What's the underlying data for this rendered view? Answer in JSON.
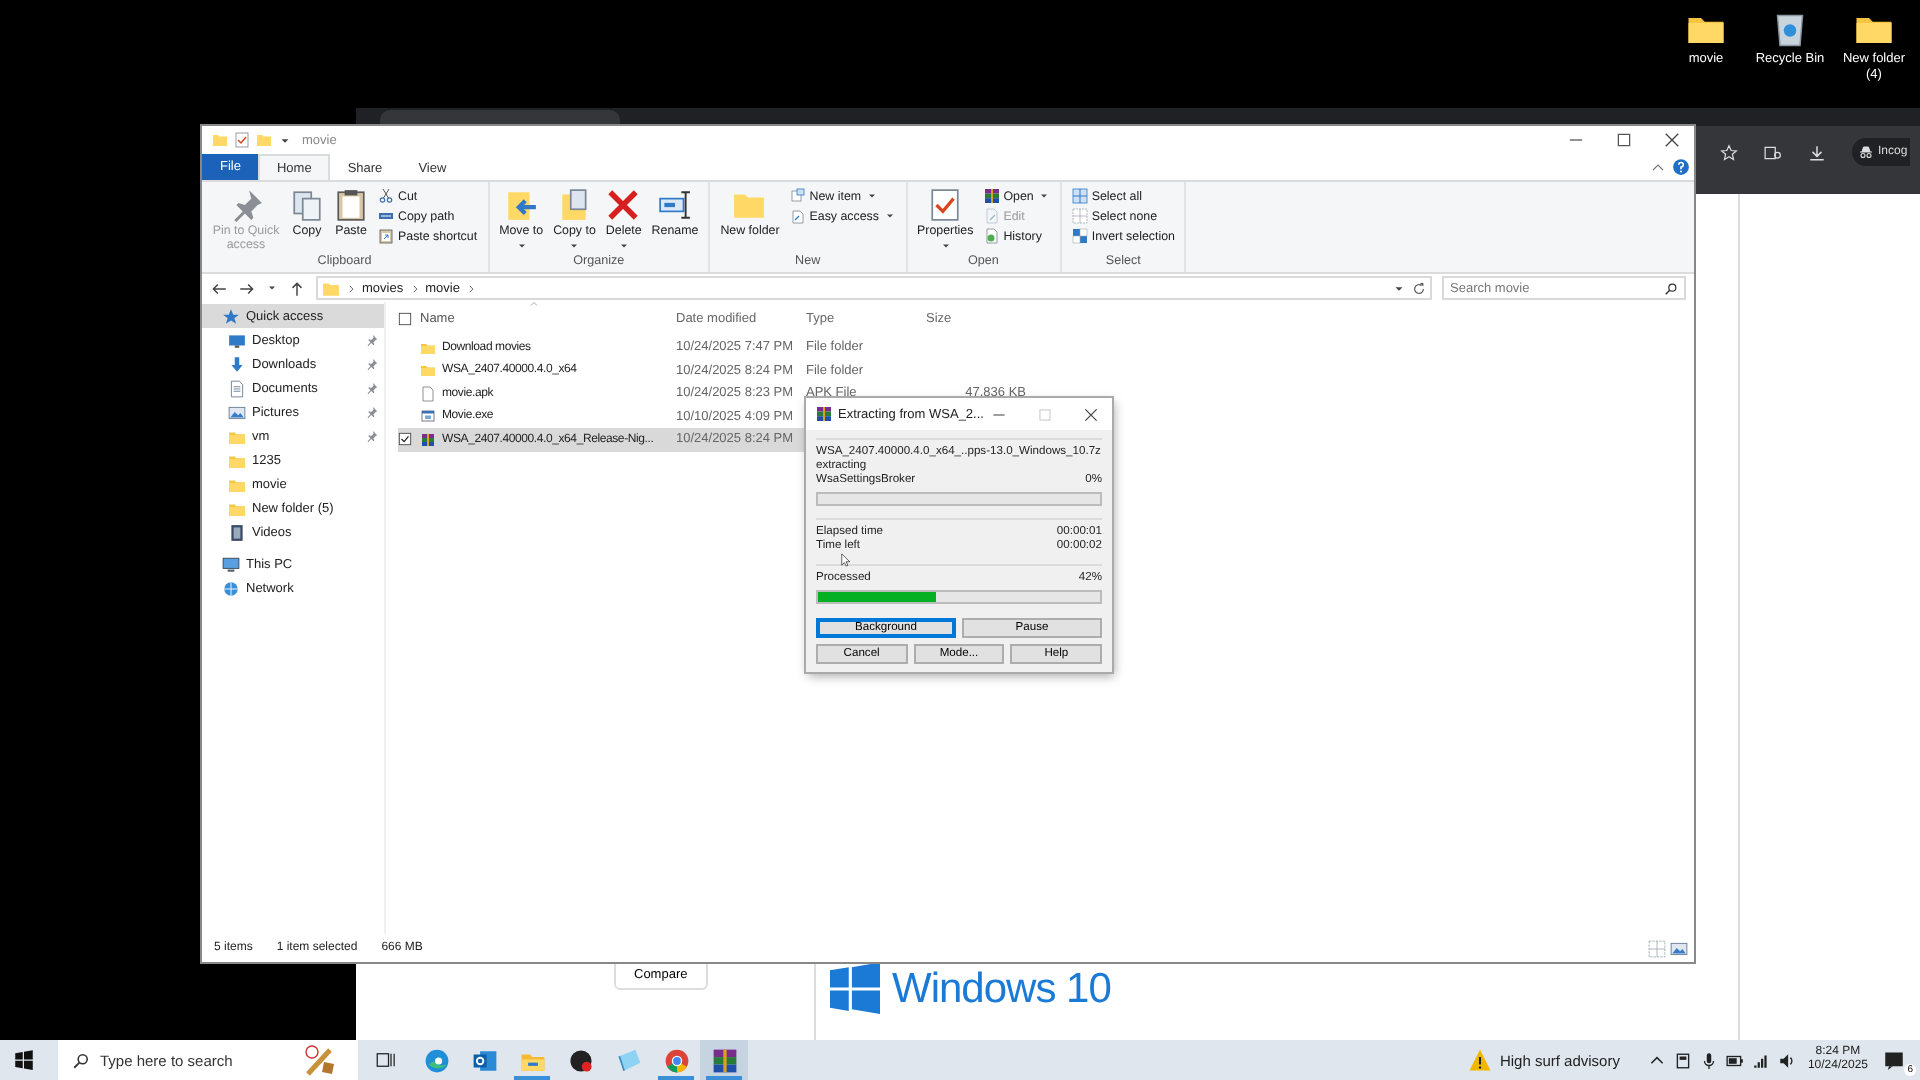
{
  "desktop_icons": [
    {
      "label": "movie",
      "kind": "folder"
    },
    {
      "label": "Recycle Bin",
      "kind": "bin"
    },
    {
      "label": "New folder (4)",
      "kind": "folder"
    }
  ],
  "browser": {
    "profile_label": "Incog",
    "compare_button": "Compare",
    "logo_text": "Windows 10"
  },
  "explorer": {
    "window": {
      "title": "movie"
    },
    "tabs": [
      {
        "label": "File",
        "kind": "file"
      },
      {
        "label": "Home",
        "selected": true,
        "kind": "tab"
      },
      {
        "label": "Share",
        "selected": false,
        "kind": "tab"
      },
      {
        "label": "View",
        "selected": false,
        "kind": "tab"
      }
    ],
    "ribbon": [
      {
        "name": "Clipboard",
        "items": [
          {
            "label": "Pin to Quick access",
            "kind": "large",
            "disabled": true,
            "dropdown": false
          },
          {
            "label": "Copy",
            "kind": "large",
            "disabled": false,
            "dropdown": false
          },
          {
            "label": "Paste",
            "kind": "large",
            "disabled": false,
            "dropdown": false
          },
          {
            "label": "Cut",
            "kind": "small",
            "disabled": false,
            "dropdown": false
          },
          {
            "label": "Copy path",
            "kind": "small",
            "disabled": false,
            "dropdown": false
          },
          {
            "label": "Paste shortcut",
            "kind": "small",
            "disabled": false,
            "dropdown": false
          }
        ]
      },
      {
        "name": "Organize",
        "items": [
          {
            "label": "Move to",
            "kind": "large",
            "disabled": false,
            "dropdown": true
          },
          {
            "label": "Copy to",
            "kind": "large",
            "disabled": false,
            "dropdown": true
          },
          {
            "label": "Delete",
            "kind": "large",
            "disabled": false,
            "dropdown": true
          },
          {
            "label": "Rename",
            "kind": "large",
            "disabled": false,
            "dropdown": false
          }
        ]
      },
      {
        "name": "New",
        "items": [
          {
            "label": "New folder",
            "kind": "large",
            "disabled": false,
            "dropdown": false
          },
          {
            "label": "New item",
            "kind": "small",
            "disabled": false,
            "dropdown": true
          },
          {
            "label": "Easy access",
            "kind": "small",
            "disabled": false,
            "dropdown": true
          }
        ]
      },
      {
        "name": "Open",
        "items": [
          {
            "label": "Properties",
            "kind": "large",
            "disabled": false,
            "dropdown": true
          },
          {
            "label": "Open",
            "kind": "small",
            "disabled": false,
            "dropdown": true
          },
          {
            "label": "Edit",
            "kind": "small",
            "disabled": true,
            "dropdown": false
          },
          {
            "label": "History",
            "kind": "small",
            "disabled": false,
            "dropdown": false
          }
        ]
      },
      {
        "name": "Select",
        "items": [
          {
            "label": "Select all",
            "kind": "small",
            "disabled": false,
            "dropdown": false
          },
          {
            "label": "Select none",
            "kind": "small",
            "disabled": false,
            "dropdown": false
          },
          {
            "label": "Invert selection",
            "kind": "small",
            "disabled": false,
            "dropdown": false
          }
        ]
      }
    ],
    "address": {
      "path": [
        "movies",
        "movie"
      ],
      "search": {
        "placeholder": "Search movie"
      }
    },
    "navigation": [
      {
        "label": "Quick access",
        "kind": "star",
        "selected": true,
        "pinned": false,
        "children": [
          {
            "label": "Desktop",
            "kind": "desktop",
            "selected": false,
            "pinned": true
          },
          {
            "label": "Downloads",
            "kind": "downloads",
            "selected": false,
            "pinned": true
          },
          {
            "label": "Documents",
            "kind": "documents",
            "selected": false,
            "pinned": true
          },
          {
            "label": "Pictures",
            "kind": "pictures",
            "selected": false,
            "pinned": true
          },
          {
            "label": "vm",
            "kind": "folder",
            "selected": false,
            "pinned": true
          },
          {
            "label": "1235",
            "kind": "folder",
            "selected": false,
            "pinned": false
          },
          {
            "label": "movie",
            "kind": "folder",
            "selected": false,
            "pinned": false
          },
          {
            "label": "New folder (5)",
            "kind": "folder",
            "selected": false,
            "pinned": false
          },
          {
            "label": "Videos",
            "kind": "videos",
            "selected": false,
            "pinned": false
          }
        ]
      },
      {
        "label": "This PC",
        "kind": "pc",
        "selected": false,
        "pinned": false
      },
      {
        "label": "Network",
        "kind": "network",
        "selected": false,
        "pinned": false
      }
    ],
    "table": {
      "all_checked": false,
      "columns": [
        "Name",
        "Date modified",
        "Type",
        "Size"
      ],
      "rows": [
        {
          "kind": "folder",
          "name": "Download movies",
          "date": "10/24/2025 7:47 PM",
          "type": "File folder",
          "selected": false,
          "checked": false
        },
        {
          "kind": "folder",
          "name": "WSA_2407.40000.4.0_x64",
          "date": "10/24/2025 8:24 PM",
          "type": "File folder",
          "selected": false,
          "checked": false
        },
        {
          "kind": "file",
          "name": "movie.apk",
          "date": "10/24/2025 8:23 PM",
          "type": "APK File",
          "size": "47,836 KB",
          "selected": false,
          "checked": false
        },
        {
          "kind": "exe",
          "name": "Movie.exe",
          "date": "10/10/2025 4:09 PM",
          "selected": false,
          "checked": false
        },
        {
          "kind": "archive",
          "name": "WSA_2407.40000.4.0_x64_Release-Nig...",
          "date": "10/24/2025 8:24 PM",
          "selected": true,
          "checked": true
        }
      ]
    },
    "status_bar": {
      "count": "5 items",
      "selection": "1 item selected",
      "size": "666 MB"
    }
  },
  "dialog": {
    "title": "Extracting from WSA_2...",
    "archive": "WSA_2407.40000.4.0_x64_..pps-13.0_Windows_10.7z",
    "action": "extracting",
    "current_file": "WsaSettingsBroker",
    "file_percent": "0%",
    "file_progress": {
      "level": 0
    },
    "times": [
      {
        "label": "Elapsed time",
        "value": "00:00:01"
      },
      {
        "label": "Time left",
        "value": "00:00:02"
      }
    ],
    "processed_label": "Processed",
    "processed_percent": "42%",
    "processed": {
      "level": 0.42
    },
    "buttons": [
      {
        "label": "Background",
        "default": true
      },
      {
        "label": "Pause",
        "default": false
      },
      {
        "label": "Cancel",
        "default": false
      },
      {
        "label": "Mode...",
        "default": false
      },
      {
        "label": "Help",
        "default": false
      }
    ]
  },
  "taskbar": {
    "search": {
      "placeholder": "Type here to search"
    },
    "apps": [
      {
        "kind": "edge",
        "running": false,
        "active": false
      },
      {
        "kind": "outlook",
        "running": false,
        "active": false
      },
      {
        "kind": "explorer",
        "running": true,
        "active": false
      },
      {
        "kind": "media",
        "running": false,
        "active": false
      },
      {
        "kind": "notes",
        "running": false,
        "active": false
      },
      {
        "kind": "chrome",
        "running": true,
        "active": false
      },
      {
        "kind": "winrar",
        "running": true,
        "active": true
      }
    ],
    "weather": "High surf advisory",
    "time": "8:24 PM",
    "date": "10/24/2025",
    "notifications": "6"
  }
}
